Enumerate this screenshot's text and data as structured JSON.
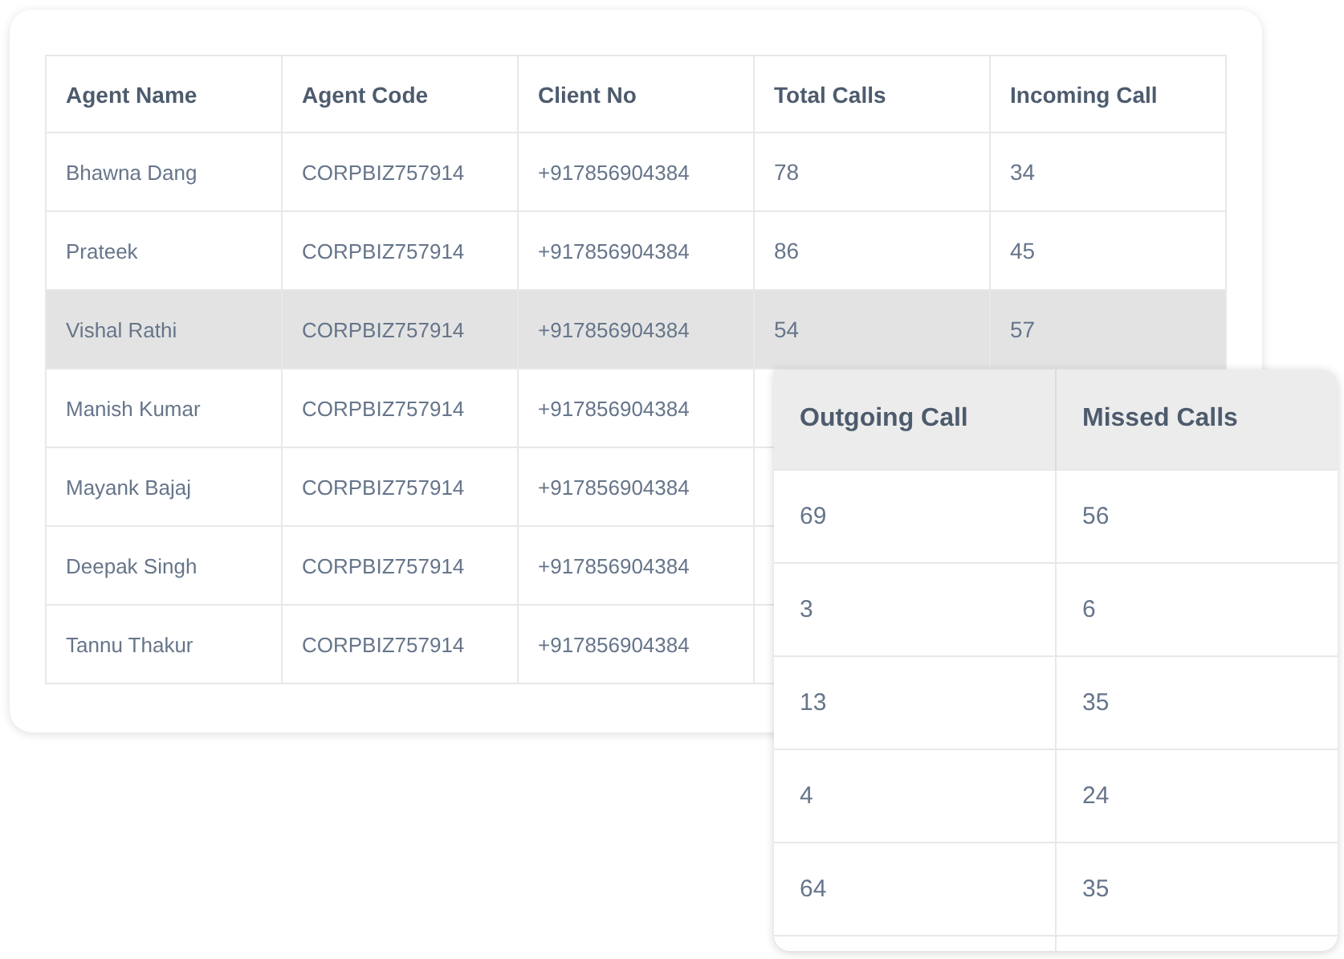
{
  "table": {
    "columns": [
      "Agent Name",
      "Agent Code",
      "Client No",
      "Total Calls",
      "Incoming Call"
    ],
    "rows": [
      {
        "name": "Bhawna Dang",
        "code": "CORPBIZ757914",
        "client": "+917856904384",
        "total": "78",
        "incoming": "34",
        "selected": false
      },
      {
        "name": "Prateek",
        "code": "CORPBIZ757914",
        "client": "+917856904384",
        "total": "86",
        "incoming": "45",
        "selected": false
      },
      {
        "name": "Vishal Rathi",
        "code": "CORPBIZ757914",
        "client": "+917856904384",
        "total": "54",
        "incoming": "57",
        "selected": true
      },
      {
        "name": "Manish Kumar",
        "code": "CORPBIZ757914",
        "client": "+917856904384",
        "selected": false
      },
      {
        "name": "Mayank Bajaj",
        "code": "CORPBIZ757914",
        "client": "+917856904384",
        "selected": false
      },
      {
        "name": "Deepak Singh",
        "code": "CORPBIZ757914",
        "client": "+917856904384",
        "selected": false
      },
      {
        "name": "Tannu Thakur",
        "code": "CORPBIZ757914",
        "client": "+917856904384",
        "selected": false
      }
    ]
  },
  "detail_table": {
    "columns": [
      "Outgoing Call",
      "Missed Calls"
    ],
    "rows": [
      {
        "outgoing": "69",
        "missed": "56"
      },
      {
        "outgoing": "3",
        "missed": "6"
      },
      {
        "outgoing": "13",
        "missed": "35"
      },
      {
        "outgoing": "4",
        "missed": "24"
      },
      {
        "outgoing": "64",
        "missed": "35"
      }
    ]
  }
}
